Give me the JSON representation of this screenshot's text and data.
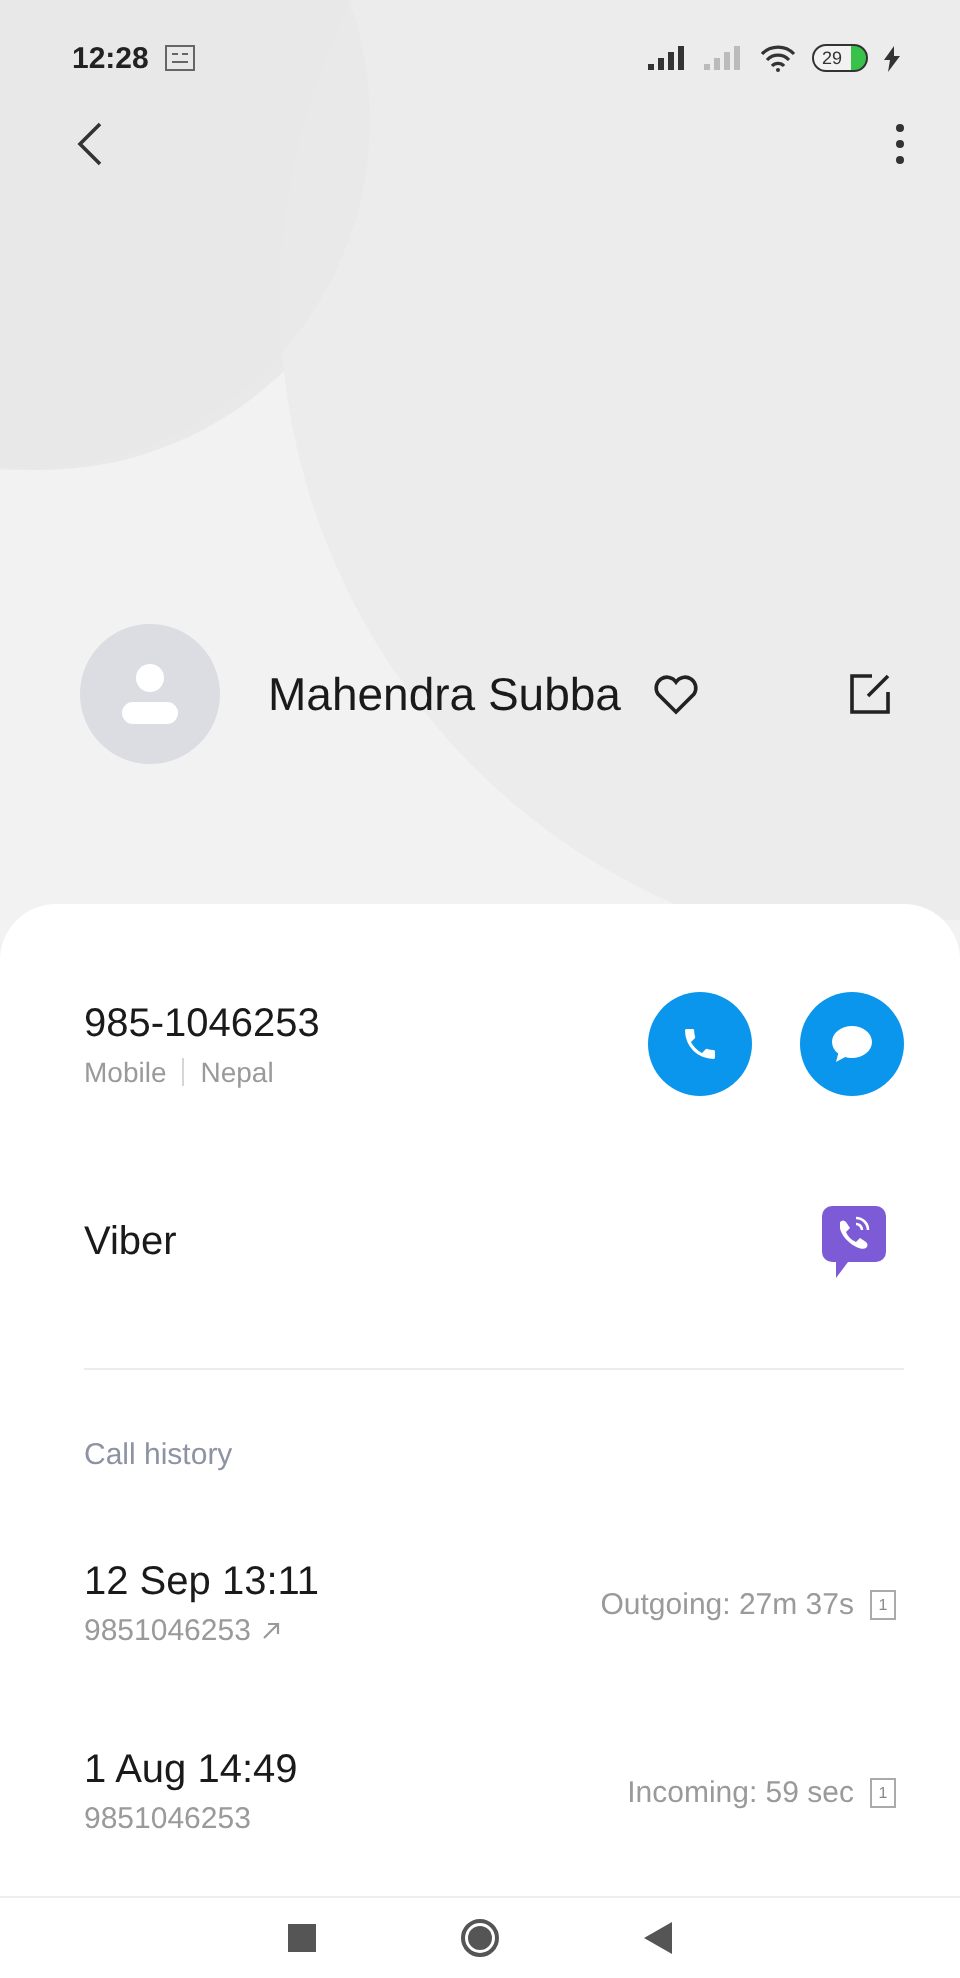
{
  "status_bar": {
    "time": "12:28",
    "battery": "29"
  },
  "contact": {
    "name": "Mahendra Subba",
    "favorite": false
  },
  "phone": {
    "number": "985-1046253",
    "type": "Mobile",
    "location": "Nepal"
  },
  "apps": [
    {
      "label": "Viber"
    }
  ],
  "call_history": {
    "title": "Call history",
    "calls": [
      {
        "date": "12 Sep 13:11",
        "number": "9851046253",
        "kind": "outgoing",
        "detail": "Outgoing: 27m 37s",
        "sim": "1"
      },
      {
        "date": "1 Aug 14:49",
        "number": "9851046253",
        "kind": "incoming",
        "detail": "Incoming: 59 sec",
        "sim": "1"
      }
    ]
  }
}
